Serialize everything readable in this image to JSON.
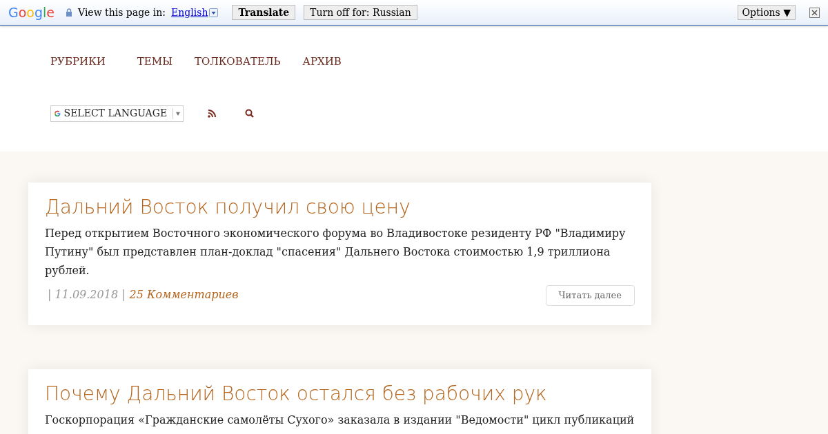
{
  "translate_bar": {
    "brand": "Google",
    "prompt": "View this page in:",
    "language": "English",
    "translate_button": "Translate",
    "turn_off_button": "Turn off for: Russian",
    "options_button": "Options ▼"
  },
  "nav": {
    "items": [
      "РУБРИКИ",
      "ТЕМЫ",
      "ТОЛКОВАТЕЛЬ",
      "АРХИВ"
    ],
    "language_select": "SELECT LANGUAGE"
  },
  "posts": [
    {
      "title": "Дальний Восток получил свою цену",
      "excerpt": "Перед открытием Восточного экономического форума во Владивостоке резиденту РФ \"Владимиру Путину\" был представлен план-доклад \"спасения\" Дальнего Востока стоимостью 1,9 триллиона рублей.",
      "date": "| 11.09.2018 |",
      "comments": "25 Комментариев",
      "read_more": "Читать далее"
    },
    {
      "title": "Почему Дальний Восток остался без рабочих рук",
      "excerpt": "Госкорпорация «Гражданские самолёты Сухого» заказала в издании \"Ведомости\" цикл публикаций"
    }
  ]
}
